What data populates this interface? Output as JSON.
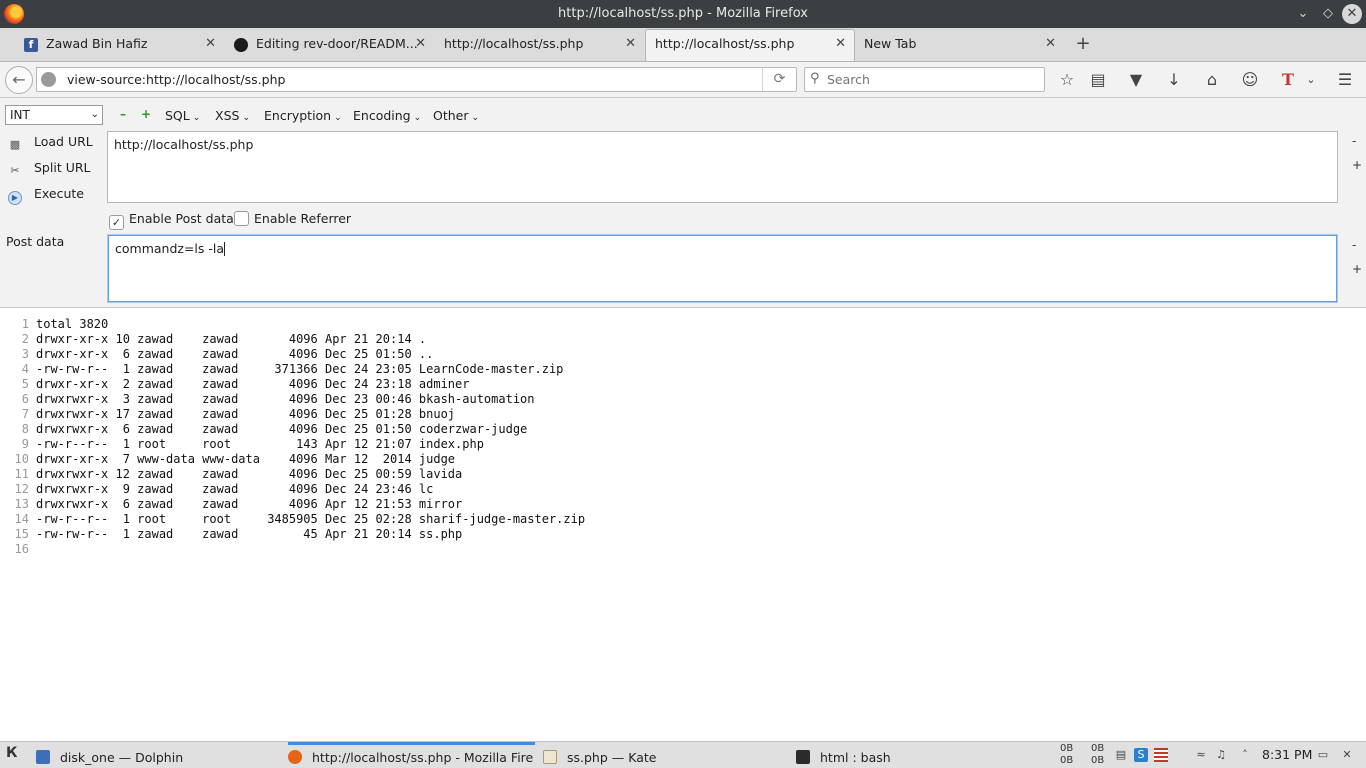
{
  "window": {
    "title": "http://localhost/ss.php - Mozilla Firefox"
  },
  "tabs": [
    {
      "label": "Zawad Bin Hafiz",
      "icon": "facebook-icon",
      "active": false
    },
    {
      "label": "Editing rev-door/READM...",
      "icon": "github-icon",
      "active": false
    },
    {
      "label": "http://localhost/ss.php",
      "icon": "none",
      "active": false
    },
    {
      "label": "http://localhost/ss.php",
      "icon": "none",
      "active": true
    },
    {
      "label": "New Tab",
      "icon": "none",
      "active": false
    }
  ],
  "newtab_label": "+",
  "navbar": {
    "url": "view-source:http://localhost/ss.php",
    "search_placeholder": "Search"
  },
  "hackbar": {
    "selector_value": "INT",
    "menus": [
      "SQL",
      "XSS",
      "Encryption",
      "Encoding",
      "Other"
    ],
    "actions": [
      "Load URL",
      "Split URL",
      "Execute"
    ],
    "url_value": "http://localhost/ss.php",
    "enable_post_label": "Enable Post data",
    "enable_post_checked": true,
    "enable_referrer_label": "Enable Referrer",
    "enable_referrer_checked": false,
    "post_label": "Post data",
    "post_value": "commandz=ls -la",
    "side_minus": "-",
    "side_plus": "+"
  },
  "source_lines": [
    {
      "n": "1",
      "text": "total 3820"
    },
    {
      "n": "2",
      "text": "drwxr-xr-x 10 zawad    zawad       4096 Apr 21 20:14 ."
    },
    {
      "n": "3",
      "text": "drwxr-xr-x  6 zawad    zawad       4096 Dec 25 01:50 .."
    },
    {
      "n": "4",
      "text": "-rw-rw-r--  1 zawad    zawad     371366 Dec 24 23:05 LearnCode-master.zip"
    },
    {
      "n": "5",
      "text": "drwxr-xr-x  2 zawad    zawad       4096 Dec 24 23:18 adminer"
    },
    {
      "n": "6",
      "text": "drwxrwxr-x  3 zawad    zawad       4096 Dec 23 00:46 bkash-automation"
    },
    {
      "n": "7",
      "text": "drwxrwxr-x 17 zawad    zawad       4096 Dec 25 01:28 bnuoj"
    },
    {
      "n": "8",
      "text": "drwxrwxr-x  6 zawad    zawad       4096 Dec 25 01:50 coderzwar-judge"
    },
    {
      "n": "9",
      "text": "-rw-r--r--  1 root     root         143 Apr 12 21:07 index.php"
    },
    {
      "n": "10",
      "text": "drwxr-xr-x  7 www-data www-data    4096 Mar 12  2014 judge"
    },
    {
      "n": "11",
      "text": "drwxrwxr-x 12 zawad    zawad       4096 Dec 25 00:59 lavida"
    },
    {
      "n": "12",
      "text": "drwxrwxr-x  9 zawad    zawad       4096 Dec 24 23:46 lc"
    },
    {
      "n": "13",
      "text": "drwxrwxr-x  6 zawad    zawad       4096 Apr 12 21:53 mirror"
    },
    {
      "n": "14",
      "text": "-rw-r--r--  1 root     root     3485905 Dec 25 02:28 sharif-judge-master.zip"
    },
    {
      "n": "15",
      "text": "-rw-rw-r--  1 zawad    zawad         45 Apr 21 20:14 ss.php"
    },
    {
      "n": "16",
      "text": ""
    }
  ],
  "taskbar": {
    "tasks": [
      {
        "label": "disk_one — Dolphin",
        "active": false
      },
      {
        "label": "http://localhost/ss.php - Mozilla Fire",
        "active": true
      },
      {
        "label": "ss.php — Kate",
        "active": false
      },
      {
        "label": "html : bash",
        "active": false
      }
    ],
    "net1_up": "0B",
    "net1_down": "0B",
    "net2_up": "0B",
    "net2_down": "0B",
    "clock": "8:31 PM"
  },
  "colors": {
    "titlebar": "#3c3f41",
    "facebook": "#3b5998",
    "active_task_indicator": "#3d8ee0",
    "hackbar_green": "#2c9b1f"
  }
}
